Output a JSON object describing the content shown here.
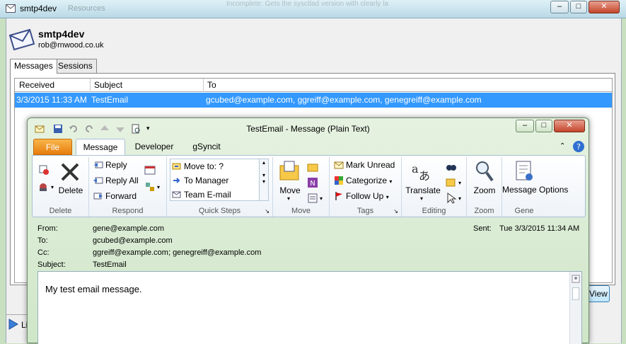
{
  "bg_window": {
    "title": "smtp4dev",
    "ghost_tab": "Resources",
    "ghost_text": "Incomplete: Gets the sysctlad version with clearly la"
  },
  "app": {
    "name": "smtp4dev",
    "account": "rob@rnwood.co.uk",
    "tabs": [
      {
        "label": "Messages"
      },
      {
        "label": "Sessions"
      }
    ],
    "grid": {
      "headers": [
        "Received",
        "Subject",
        "To"
      ],
      "rows": [
        {
          "received": "3/3/2015 11:33 AM",
          "subject": "TestEmail",
          "to": "gcubed@example.com, ggreiff@example.com, genegreiff@example.com"
        }
      ]
    },
    "view_button": "View",
    "listen_label": "Li"
  },
  "message_window": {
    "title": "TestEmail  -  Message (Plain Text)",
    "ribbon_tabs": [
      {
        "label": "File"
      },
      {
        "label": "Message"
      },
      {
        "label": "Developer"
      },
      {
        "label": "gSyncit"
      }
    ],
    "groups": {
      "delete": {
        "label": "Delete",
        "delete_button": "Delete"
      },
      "respond": {
        "label": "Respond",
        "reply": "Reply",
        "reply_all": "Reply All",
        "forward": "Forward"
      },
      "quick_steps": {
        "label": "Quick Steps",
        "items": [
          "Move to: ?",
          "To Manager",
          "Team E-mail"
        ]
      },
      "move": {
        "label": "Move",
        "move_button": "Move"
      },
      "tags": {
        "label": "Tags",
        "mark_unread": "Mark Unread",
        "categorize": "Categorize",
        "follow_up": "Follow Up"
      },
      "editing": {
        "label": "Editing",
        "translate": "Translate"
      },
      "zoom": {
        "label": "Zoom",
        "zoom_button": "Zoom"
      },
      "gene": {
        "label": "Gene",
        "message_options": "Message Options"
      }
    },
    "headers": {
      "from_label": "From:",
      "from": "gene@example.com",
      "to_label": "To:",
      "to": "gcubed@example.com",
      "cc_label": "Cc:",
      "cc": "ggreiff@example.com; genegreiff@example.com",
      "subject_label": "Subject:",
      "subject": "TestEmail",
      "sent_label": "Sent:",
      "sent": "Tue 3/3/2015 11:34 AM"
    },
    "body": "My test email message."
  },
  "colors": {
    "selection": "#3399ff",
    "file_tab": "#e87c0c",
    "outlook_frame": "#cfe6c8"
  }
}
